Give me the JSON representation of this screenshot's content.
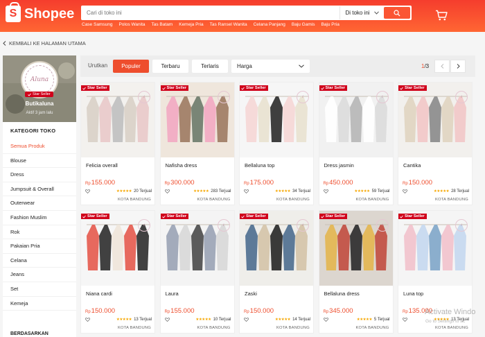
{
  "header": {
    "logo_text": "Shopee",
    "logo_glyph": "S",
    "search_placeholder": "Cari di toko ini",
    "search_scope": "Di toko ini",
    "suggestions": [
      "Case Samsung",
      "Polos Wanita",
      "Tas Batam",
      "Kemeja Pria",
      "Tas Ransel Wanita",
      "Celana Panjang",
      "Baju Gamis",
      "Baju Pria"
    ],
    "brand_color": "#f53d2d"
  },
  "back_link": "KEMBALI KE HALAMAN UTAMA",
  "shop": {
    "name": "Butikaluna",
    "status": "Aktif 3 jam lalu",
    "badge": "Star Seller",
    "logo_text": "Aluna"
  },
  "categories": {
    "title": "KATEGORI TOKO",
    "items": [
      "Semua Produk",
      "Blouse",
      "Dress",
      "Jumpsuit & Overall",
      "Outerwear",
      "Fashion Muslim",
      "Rok",
      "Pakaian Pria",
      "Celana",
      "Jeans",
      "Set",
      "Kemeja"
    ],
    "active_index": 0,
    "next_section_title": "BERDASARKAN"
  },
  "sortbar": {
    "label": "Urutkan",
    "options": [
      "Populer",
      "Terbaru",
      "Terlaris"
    ],
    "active": "Populer",
    "price_select": "Harga",
    "page_current": "1",
    "page_total": "/3"
  },
  "products": [
    {
      "name": "Felicia overall",
      "currency": "Rp",
      "price": "155.000",
      "rating": 5,
      "sold": "20 Terjual",
      "location": "KOTA BANDUNG",
      "badge": "Star Seller"
    },
    {
      "name": "Nafisha dress",
      "currency": "Rp",
      "price": "300.000",
      "rating": 5,
      "sold": "283 Terjual",
      "location": "KOTA BANDUNG",
      "badge": "Star Seller"
    },
    {
      "name": "Bellaluna top",
      "currency": "Rp",
      "price": "175.000",
      "rating": 5,
      "sold": "34 Terjual",
      "location": "KOTA BANDUNG",
      "badge": "Star Seller"
    },
    {
      "name": "Dress jasmin",
      "currency": "Rp",
      "price": "450.000",
      "rating": 5,
      "sold": "59 Terjual",
      "location": "KOTA BANDUNG",
      "badge": "Star Seller"
    },
    {
      "name": "Cantika",
      "currency": "Rp",
      "price": "150.000",
      "rating": 5,
      "sold": "28 Terjual",
      "location": "KOTA BANDUNG",
      "badge": "Star Seller"
    },
    {
      "name": "Niana cardi",
      "currency": "Rp",
      "price": "150.000",
      "rating": 5,
      "sold": "13 Terjual",
      "location": "KOTA BANDUNG",
      "badge": "Star Seller"
    },
    {
      "name": "Laura",
      "currency": "Rp",
      "price": "155.000",
      "rating": 5,
      "sold": "10 Terjual",
      "location": "KOTA BANDUNG",
      "badge": "Star Seller"
    },
    {
      "name": "Zaski",
      "currency": "Rp",
      "price": "150.000",
      "rating": 5,
      "sold": "14 Terjual",
      "location": "KOTA BANDUNG",
      "badge": "Star Seller"
    },
    {
      "name": "Bellaluna dress",
      "currency": "Rp",
      "price": "345.000",
      "rating": 5,
      "sold": "5 Terjual",
      "location": "KOTA BANDUNG",
      "badge": "Star Seller"
    },
    {
      "name": "Luna top",
      "currency": "Rp",
      "price": "135.000",
      "rating": 5,
      "sold": "13 Terjual",
      "location": "KOTA BANDUNG",
      "badge": "Star Seller"
    }
  ],
  "watermark": {
    "title": "Activate Windo",
    "subtitle": "Go to Settings to ac"
  }
}
